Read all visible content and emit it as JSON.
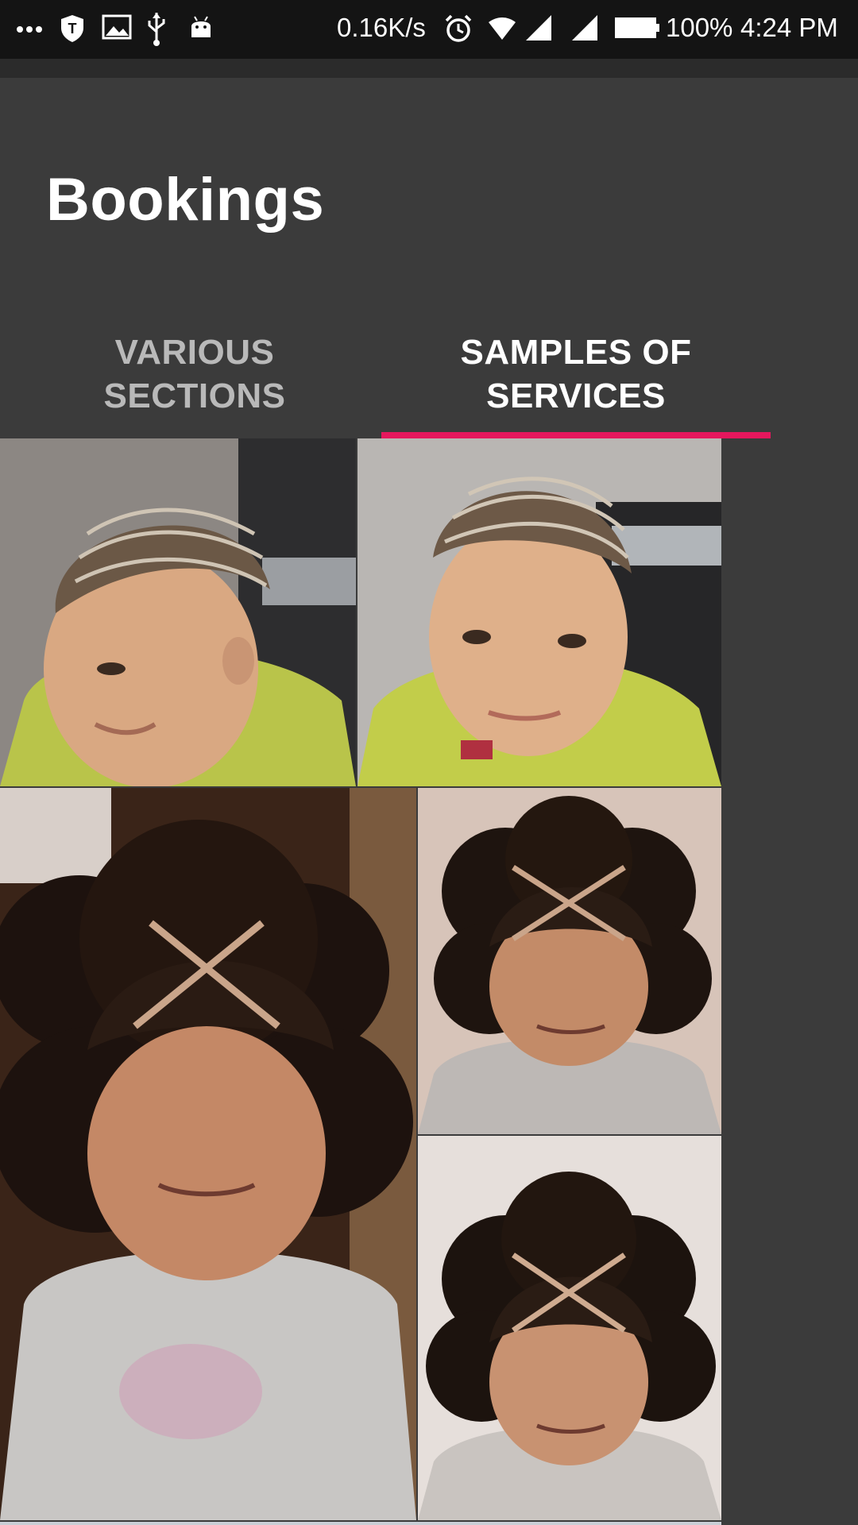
{
  "status_bar": {
    "network_speed": "0.16K/s",
    "battery": "100%",
    "time": "4:24 PM",
    "icons": [
      "dots-icon",
      "shield-icon",
      "image-icon",
      "usb-icon",
      "android-icon",
      "alarm-icon",
      "wifi-icon",
      "signal-icon",
      "signal-icon",
      "battery-icon"
    ]
  },
  "app_bar": {
    "title": "Bookings"
  },
  "tabs": [
    {
      "label": "VARIOUS SECTIONS",
      "selected": false
    },
    {
      "label": "SAMPLES OF SERVICES",
      "selected": true
    }
  ],
  "colors": {
    "accent": "#e5175d",
    "app_bar": "#3b3b3b",
    "status_bar": "#141414"
  },
  "gallery": {
    "images": [
      "boy-braided-haircut-side-photo",
      "boy-braided-haircut-front-photo",
      "girl-curly-puffs-crossed-braids-photo",
      "girl-crossed-braids-top-photo",
      "girl-crossed-braids-bottom-photo"
    ]
  }
}
